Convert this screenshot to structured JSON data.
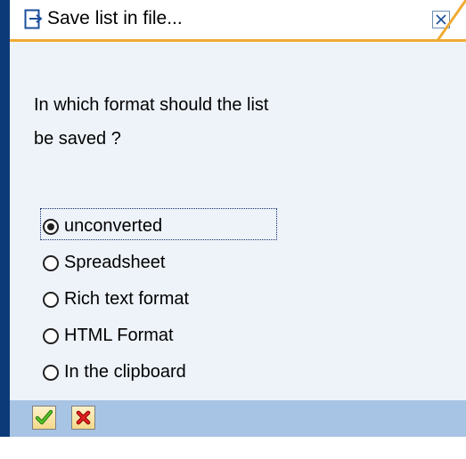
{
  "window": {
    "title": "Save list in file..."
  },
  "question": {
    "line1": "In which format should the list",
    "line2": "be saved ?"
  },
  "options": [
    {
      "label": "unconverted",
      "selected": true
    },
    {
      "label": "Spreadsheet",
      "selected": false
    },
    {
      "label": "Rich text format",
      "selected": false
    },
    {
      "label": "HTML Format",
      "selected": false
    },
    {
      "label": "In the clipboard",
      "selected": false
    }
  ],
  "footer": {
    "buttons": [
      {
        "icon": "checkmark-icon",
        "action": "continue"
      },
      {
        "icon": "cancel-x-icon",
        "action": "cancel"
      }
    ]
  },
  "colors": {
    "frame": "#0c3a78",
    "accent": "#f0ab33",
    "content_bg": "#eef3fa",
    "footer_bg": "#a8c4e4",
    "ok_green": "#3a9a1a",
    "cancel_red": "#d01818"
  }
}
